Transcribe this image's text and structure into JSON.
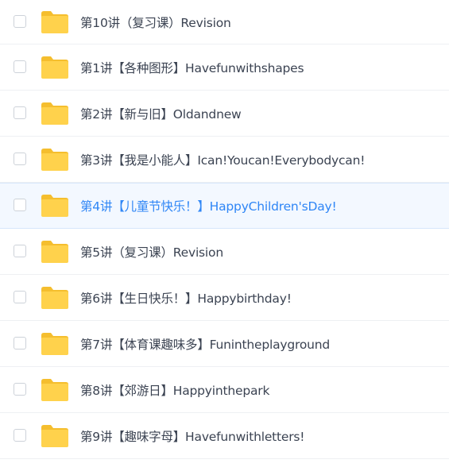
{
  "files": [
    {
      "name": "第10讲（复习课）Revision",
      "selected": false
    },
    {
      "name": "第1讲【各种图形】Havefunwithshapes",
      "selected": false
    },
    {
      "name": "第2讲【新与旧】Oldandnew",
      "selected": false
    },
    {
      "name": "第3讲【我是小能人】Ican!Youcan!Everybodycan!",
      "selected": false
    },
    {
      "name": "第4讲【儿童节快乐！】HappyChildren'sDay!",
      "selected": true
    },
    {
      "name": "第5讲（复习课）Revision",
      "selected": false
    },
    {
      "name": "第6讲【生日快乐！】Happybirthday!",
      "selected": false
    },
    {
      "name": "第7讲【体育课趣味多】Funintheplayground",
      "selected": false
    },
    {
      "name": "第8讲【郊游日】Happyinthepark",
      "selected": false
    },
    {
      "name": "第9讲【趣味字母】Havefunwithletters!",
      "selected": false
    }
  ],
  "icons": {
    "folder": "folder-icon",
    "checkbox": "checkbox"
  },
  "colors": {
    "folder": "#FFD24C",
    "folder_tab": "#F5BE2E",
    "selected_text": "#2F86F6",
    "selected_bg": "#F3F8FF",
    "text": "#3B4352"
  }
}
